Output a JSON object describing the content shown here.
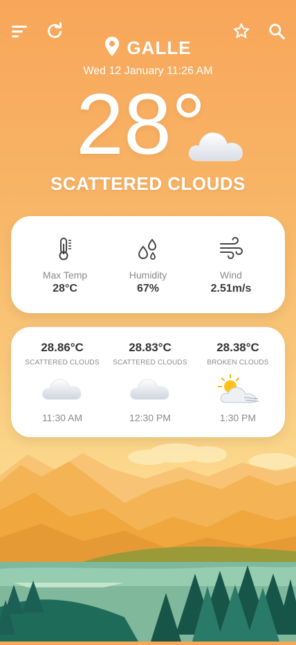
{
  "header": {
    "menu_icon": "menu-icon",
    "refresh_icon": "refresh-icon",
    "favorite_icon": "star-icon",
    "search_icon": "search-icon",
    "location_icon": "location-pin-icon",
    "city": "GALLE",
    "datetime": "Wed 12 January 11:26 AM"
  },
  "current": {
    "temperature": "28°",
    "condition_icon": "cloud-icon",
    "condition": "SCATTERED CLOUDS"
  },
  "stats": [
    {
      "icon": "thermometer-icon",
      "label": "Max Temp",
      "value": "28°C"
    },
    {
      "icon": "humidity-drops-icon",
      "label": "Humidity",
      "value": "67%"
    },
    {
      "icon": "wind-icon",
      "label": "Wind",
      "value": "2.51m/s"
    }
  ],
  "forecast": [
    {
      "temp": "28.86°C",
      "desc": "SCATTERED CLOUDS",
      "icon": "cloud-icon",
      "time": "11:30 AM"
    },
    {
      "temp": "28.83°C",
      "desc": "SCATTERED CLOUDS",
      "icon": "cloud-icon",
      "time": "12:30 PM"
    },
    {
      "temp": "28.38°C",
      "desc": "BROKEN CLOUDS",
      "icon": "sun-cloud-icon",
      "time": "1:30 PM"
    }
  ],
  "colors": {
    "gradient_top": "#f8a65a",
    "gradient_bottom": "#fbe29c",
    "card_background": "#ffffff",
    "value_text": "#3a3a3a",
    "label_text": "#8a8a8a"
  }
}
